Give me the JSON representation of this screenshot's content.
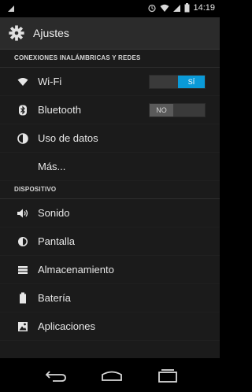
{
  "status_bar": {
    "time": "14:19",
    "icons": [
      "notification-icon",
      "alarm-icon",
      "wifi-icon",
      "signal-icon",
      "battery-icon"
    ]
  },
  "app_bar": {
    "title": "Ajustes",
    "icon": "settings-gear-icon"
  },
  "sections": {
    "wireless": {
      "header": "CONEXIONES INALÁMBRICAS Y REDES",
      "wifi": {
        "label": "Wi-Fi",
        "icon": "wifi-icon",
        "toggle": "SÍ"
      },
      "bluetooth": {
        "label": "Bluetooth",
        "icon": "bluetooth-icon",
        "toggle": "NO"
      },
      "data_usage": {
        "label": "Uso de datos",
        "icon": "data-usage-icon"
      },
      "more": {
        "label": "Más..."
      }
    },
    "device": {
      "header": "DISPOSITIVO",
      "sound": {
        "label": "Sonido",
        "icon": "sound-icon"
      },
      "display": {
        "label": "Pantalla",
        "icon": "display-icon"
      },
      "storage": {
        "label": "Almacenamiento",
        "icon": "storage-icon"
      },
      "battery": {
        "label": "Batería",
        "icon": "battery-icon"
      },
      "apps": {
        "label": "Aplicaciones",
        "icon": "apps-icon"
      }
    }
  },
  "nav_bar": {
    "buttons": [
      "back-icon",
      "home-icon",
      "recents-icon"
    ]
  },
  "colors": {
    "accent": "#0a9ad8",
    "background": "#1b1b1b",
    "app_bar": "#2b2b2b"
  }
}
